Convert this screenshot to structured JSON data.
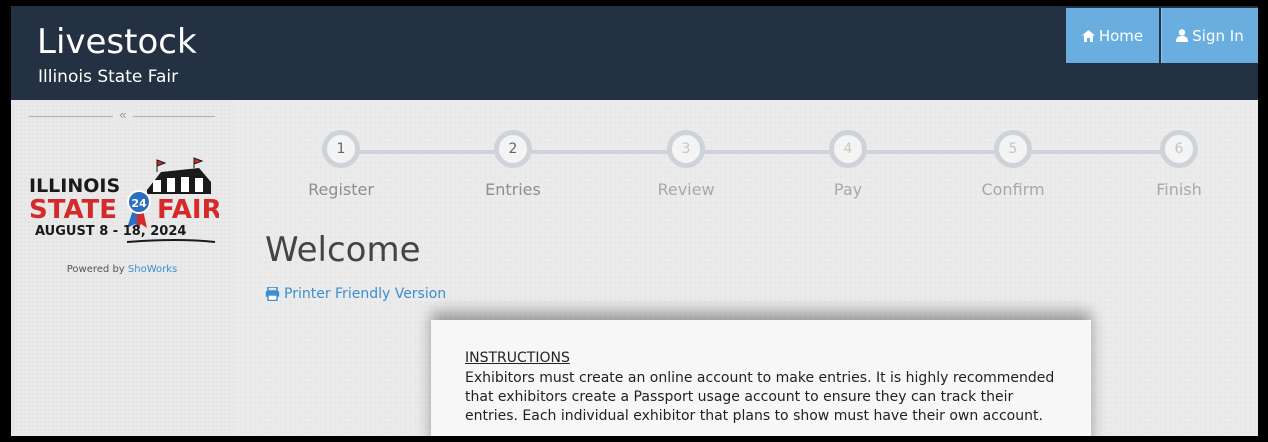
{
  "header": {
    "title": "Livestock",
    "subtitle": "Illinois State Fair",
    "nav": {
      "home_label": "Home",
      "home_icon": "home-icon",
      "signin_label": "Sign In",
      "signin_icon": "user-icon"
    }
  },
  "sidebar": {
    "collapse_glyph": "«",
    "logo": {
      "line1": "ILLINOIS",
      "line2_left": "STATE",
      "line2_right": "FAIR",
      "badge": "24",
      "dates": "AUGUST 8 - 18, 2024"
    },
    "powered_prefix": "Powered by",
    "powered_link": "ShoWorks"
  },
  "stepper": {
    "steps": [
      {
        "number": "1",
        "label": "Register",
        "state": "active"
      },
      {
        "number": "2",
        "label": "Entries",
        "state": "active"
      },
      {
        "number": "3",
        "label": "Review",
        "state": "inactive"
      },
      {
        "number": "4",
        "label": "Pay",
        "state": "inactive"
      },
      {
        "number": "5",
        "label": "Confirm",
        "state": "inactive"
      },
      {
        "number": "6",
        "label": "Finish",
        "state": "inactive"
      }
    ]
  },
  "main": {
    "heading": "Welcome",
    "printer_link": "Printer Friendly Version",
    "printer_icon": "print-icon"
  },
  "instructions": {
    "heading": "INSTRUCTIONS",
    "body": "Exhibitors must create an online account to make entries. It is highly recommended that exhibitors create a Passport usage account to ensure they can track their entries. Each individual exhibitor that plans to show must have their own account."
  },
  "colors": {
    "header_bg": "#233142",
    "nav_button_bg": "#6aaee0",
    "link": "#3b8fd0",
    "logo_red": "#d42a2a",
    "logo_blue": "#2a6fc0"
  }
}
